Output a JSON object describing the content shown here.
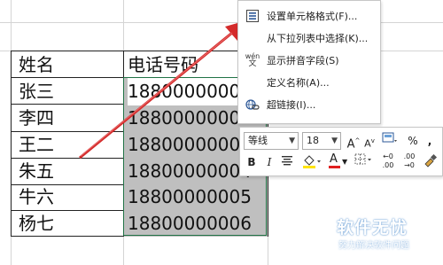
{
  "sheet": {
    "header_name": "姓名",
    "header_phone": "电话号码",
    "rows": [
      {
        "name": "张三",
        "phone": "18800000001"
      },
      {
        "name": "李四",
        "phone": "18800000002"
      },
      {
        "name": "王二",
        "phone": "18800000003"
      },
      {
        "name": "朱五",
        "phone": "18800000004"
      },
      {
        "name": "牛六",
        "phone": "18800000005"
      },
      {
        "name": "杨七",
        "phone": "18800000006"
      }
    ]
  },
  "context_menu": {
    "items": [
      {
        "label": "设置单元格格式(F)...",
        "icon": "format-cells-icon"
      },
      {
        "label": "从下拉列表中选择(K)...",
        "icon": ""
      },
      {
        "label": "显示拼音字段(S)",
        "icon": "phonetic-icon",
        "icon_text_top": "wén",
        "icon_text_bottom": "文"
      },
      {
        "label": "定义名称(A)...",
        "icon": ""
      },
      {
        "label": "超链接(I)...",
        "icon": "hyperlink-icon"
      }
    ]
  },
  "mini_toolbar": {
    "font_name": "等线",
    "font_size": "18",
    "grow_font": "A",
    "shrink_font": "A",
    "percent": "%",
    "comma": ",",
    "bold": "B",
    "italic": "I",
    "font_color": "A",
    "inc_decimal_top": "←0",
    "inc_decimal_bottom": ".00",
    "dec_decimal_top": ".00",
    "dec_decimal_bottom": "→0"
  },
  "watermark": {
    "title": "软件无忧",
    "subtitle": "努力解决软件问题"
  },
  "colors": {
    "arrow": "#d42b2b",
    "selection_border": "#217346",
    "selection_fill": "#bfbfbf",
    "font_color_bar": "#e02020",
    "highlight_bar": "#ffe400"
  }
}
